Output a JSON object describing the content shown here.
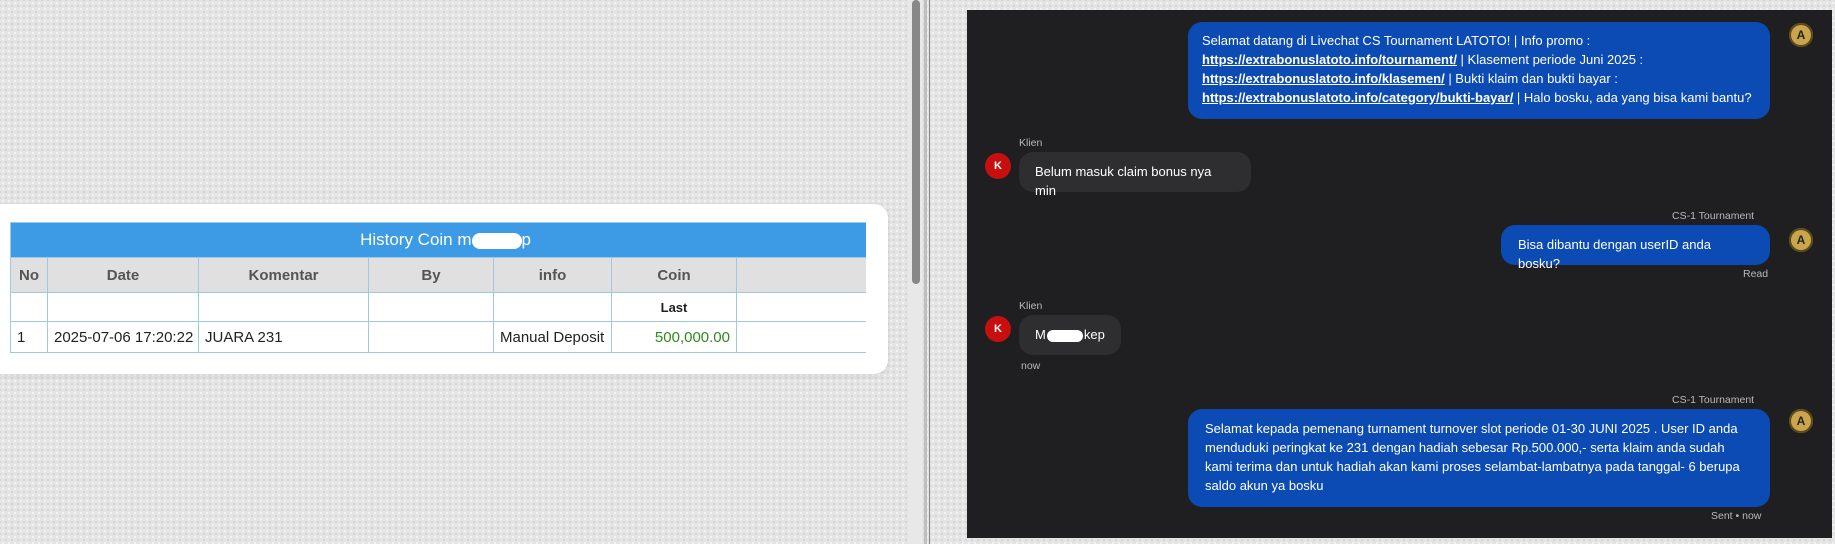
{
  "coin_table": {
    "title_prefix": "History Coin m",
    "title_suffix": "p",
    "headers": [
      "No",
      "Date",
      "Komentar",
      "By",
      "info",
      "Coin"
    ],
    "subheader_last": "Last",
    "rows": [
      {
        "no": "1",
        "date": "2025-07-06 17:20:22",
        "komentar": "JUARA 231",
        "by": "",
        "info": "Manual Deposit",
        "coin": "500,000.00"
      }
    ]
  },
  "chat": {
    "avatar_agent_letter": "A",
    "avatar_client_letter": "K",
    "msg1": {
      "t1": "Selamat datang di Livechat CS Tournament LATOTO! | Info promo :",
      "link1": "https://extrabonuslatoto.info/tournament/",
      "t2": " | Klasement periode Juni 2025 :",
      "link2": "https://extrabonuslatoto.info/klasemen/",
      "t3": " | Bukti klaim dan bukti bayar :",
      "link3": "https://extrabonuslatoto.info/category/bukti-bayar/",
      "t4": " | Halo bosku, ada yang bisa kami bantu?"
    },
    "client_name_1": "Klien",
    "msg2": "Belum masuk claim bonus nya min",
    "agent_name_1": "CS-1 Tournament",
    "msg3": "Bisa dibantu dengan userID anda bosku?",
    "read_label": "Read",
    "client_name_2": "Klien",
    "msg4_prefix": "M",
    "msg4_suffix": "kep",
    "now_label": "now",
    "agent_name_2": "CS-1 Tournament",
    "msg5": "Selamat kepada pemenang turnament turnover slot periode 01-30 JUNI 2025 . User ID anda menduduki peringkat ke 231 dengan hadiah sebesar Rp.500.000,- serta klaim anda sudah kami terima dan untuk hadiah akan kami proses selambat-lambatnya pada tanggal- 6 berupa saldo akun ya bosku",
    "sent_label": "Sent • now"
  }
}
